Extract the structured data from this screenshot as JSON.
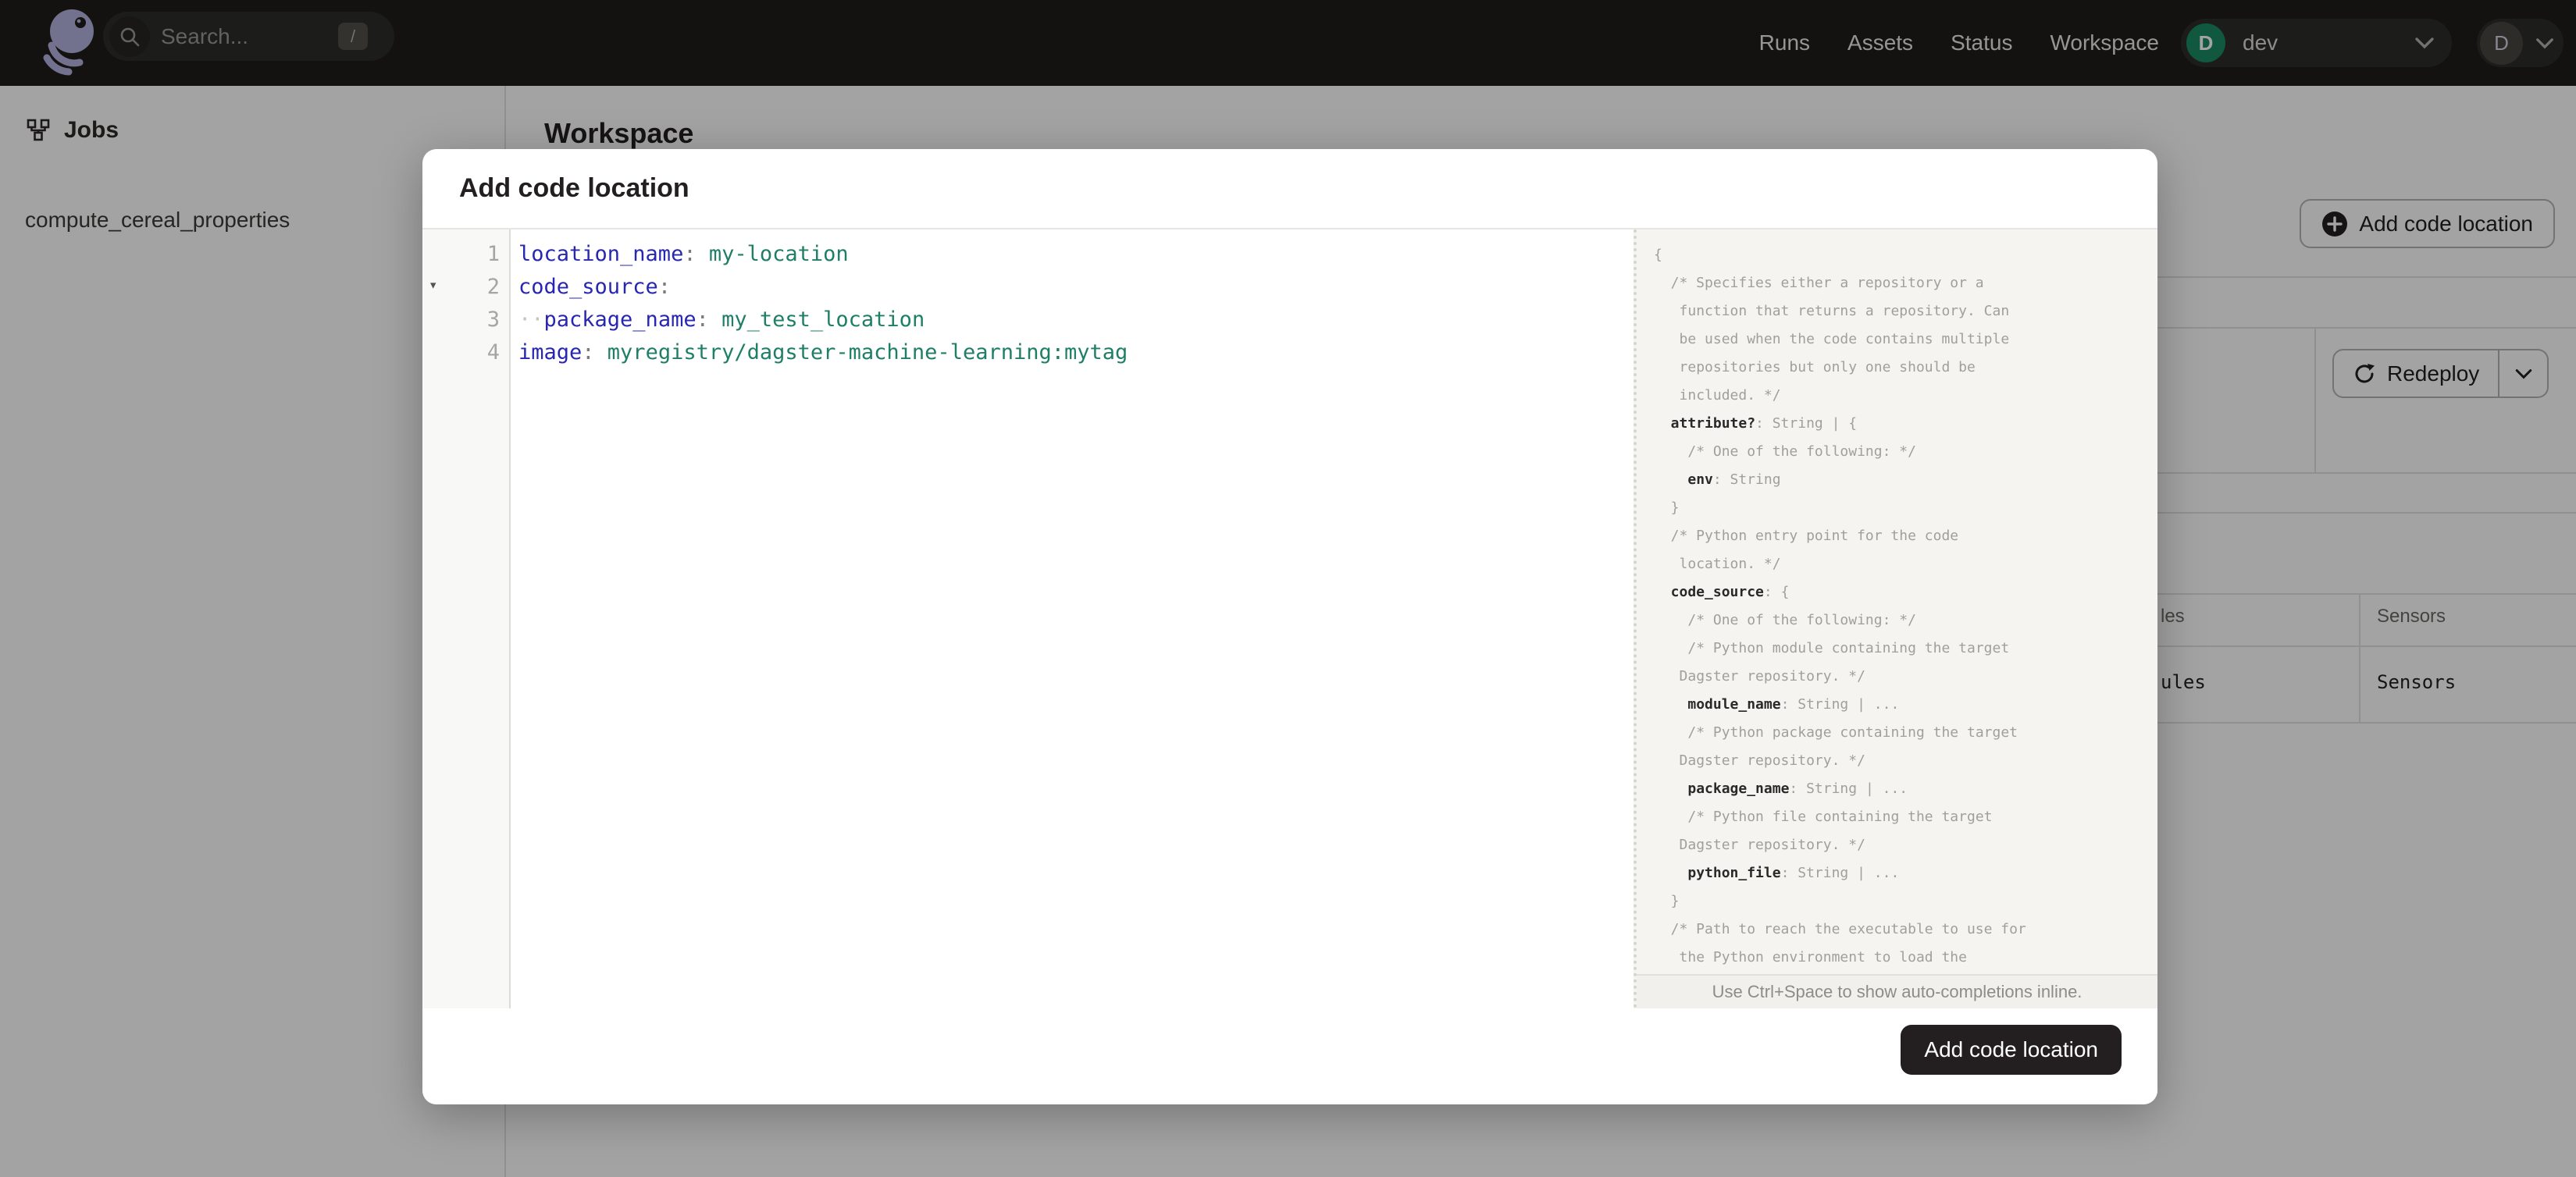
{
  "nav": {
    "search": {
      "placeholder": "Search...",
      "shortcut": "/"
    },
    "links": [
      "Runs",
      "Assets",
      "Status",
      "Workspace"
    ],
    "deployment": {
      "initial": "D",
      "name": "dev"
    },
    "user_initial": "D"
  },
  "sidebar": {
    "section_label": "Jobs",
    "items": [
      "compute_cereal_properties"
    ]
  },
  "page": {
    "title": "Workspace",
    "add_button_label": "Add code location",
    "redeploy_label": "Redeploy",
    "table_header_fragments": [
      "les",
      "Sensors"
    ],
    "table_row_fragments": [
      "ules",
      "Sensors"
    ]
  },
  "modal": {
    "title": "Add code location",
    "submit_label": "Add code location",
    "hint": "Use Ctrl+Space to show auto-completions inline.",
    "editor": {
      "lines": [
        {
          "n": "1",
          "segs": [
            [
              "key",
              "location_name"
            ],
            [
              "pun",
              ": "
            ],
            [
              "val",
              "my-location"
            ]
          ]
        },
        {
          "n": "2",
          "fold": true,
          "segs": [
            [
              "key",
              "code_source"
            ],
            [
              "pun",
              ":"
            ]
          ]
        },
        {
          "n": "3",
          "segs": [
            [
              "dots",
              "··"
            ],
            [
              "key",
              "package_name"
            ],
            [
              "pun",
              ": "
            ],
            [
              "val",
              "my_test_location"
            ]
          ]
        },
        {
          "n": "4",
          "segs": [
            [
              "key",
              "image"
            ],
            [
              "pun",
              ": "
            ],
            [
              "val",
              "myregistry/dagster-machine-learning:mytag"
            ]
          ]
        }
      ]
    },
    "schema_doc": {
      "lines": [
        {
          "ind": 0,
          "segs": [
            [
              "m",
              "{"
            ]
          ]
        },
        {
          "ind": 2,
          "segs": [
            [
              "m",
              "/* Specifies either a repository or a"
            ]
          ]
        },
        {
          "ind": 3,
          "segs": [
            [
              "m",
              "function that returns a repository. Can"
            ]
          ]
        },
        {
          "ind": 3,
          "segs": [
            [
              "m",
              "be used when the code contains multiple"
            ]
          ]
        },
        {
          "ind": 3,
          "segs": [
            [
              "m",
              "repositories but only one should be"
            ]
          ]
        },
        {
          "ind": 3,
          "segs": [
            [
              "m",
              "included. */"
            ]
          ]
        },
        {
          "ind": 2,
          "segs": [
            [
              "k",
              "attribute?"
            ],
            [
              "m",
              ": String | {"
            ]
          ]
        },
        {
          "ind": 4,
          "segs": [
            [
              "m",
              "/* One of the following: */"
            ]
          ]
        },
        {
          "ind": 4,
          "segs": [
            [
              "k",
              "env"
            ],
            [
              "m",
              ": String"
            ]
          ]
        },
        {
          "ind": 2,
          "segs": [
            [
              "m",
              "}"
            ]
          ]
        },
        {
          "ind": 2,
          "segs": [
            [
              "m",
              "/* Python entry point for the code"
            ]
          ]
        },
        {
          "ind": 3,
          "segs": [
            [
              "m",
              "location. */"
            ]
          ]
        },
        {
          "ind": 2,
          "segs": [
            [
              "k",
              "code_source"
            ],
            [
              "m",
              ": {"
            ]
          ]
        },
        {
          "ind": 4,
          "segs": [
            [
              "m",
              "/* One of the following: */"
            ]
          ]
        },
        {
          "ind": 4,
          "segs": [
            [
              "m",
              "/* Python module containing the target"
            ]
          ]
        },
        {
          "ind": 3,
          "segs": [
            [
              "m",
              "Dagster repository. */"
            ]
          ]
        },
        {
          "ind": 4,
          "segs": [
            [
              "k",
              "module_name"
            ],
            [
              "m",
              ": String | ..."
            ]
          ]
        },
        {
          "ind": 4,
          "segs": [
            [
              "m",
              "/* Python package containing the target"
            ]
          ]
        },
        {
          "ind": 3,
          "segs": [
            [
              "m",
              "Dagster repository. */"
            ]
          ]
        },
        {
          "ind": 4,
          "segs": [
            [
              "k",
              "package_name"
            ],
            [
              "m",
              ": String | ..."
            ]
          ]
        },
        {
          "ind": 4,
          "segs": [
            [
              "m",
              "/* Python file containing the target"
            ]
          ]
        },
        {
          "ind": 3,
          "segs": [
            [
              "m",
              "Dagster repository. */"
            ]
          ]
        },
        {
          "ind": 4,
          "segs": [
            [
              "k",
              "python_file"
            ],
            [
              "m",
              ": String | ..."
            ]
          ]
        },
        {
          "ind": 2,
          "segs": [
            [
              "m",
              "}"
            ]
          ]
        },
        {
          "ind": 2,
          "segs": [
            [
              "m",
              "/* Path to reach the executable to use for"
            ]
          ]
        },
        {
          "ind": 3,
          "segs": [
            [
              "m",
              "the Python environment to load the"
            ]
          ]
        }
      ]
    }
  },
  "colors": {
    "nav_bg": "#1e1d1a",
    "accent_green": "#1a8a64",
    "key_blue": "#2727b2",
    "value_green": "#1e7f66",
    "dark_button": "#231f20"
  }
}
